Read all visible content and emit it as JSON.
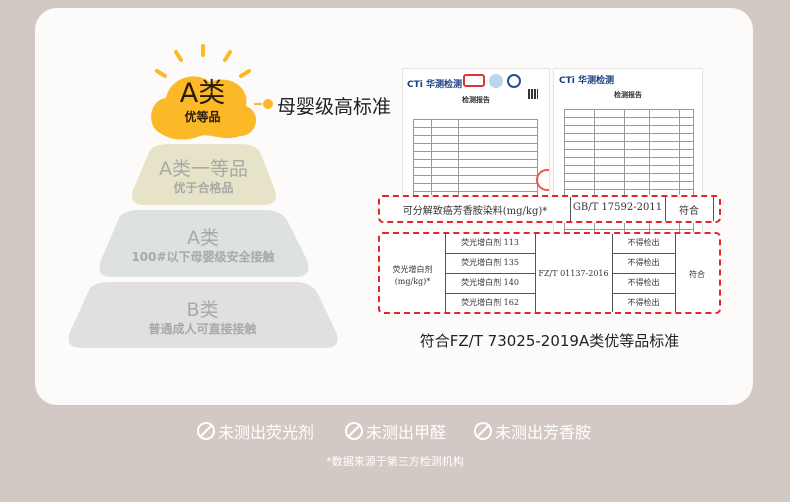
{
  "pyramid": {
    "top": {
      "title": "A类",
      "subtitle": "优等品",
      "callout": "母婴级高标准"
    },
    "tiers": [
      {
        "title": "A类一等品",
        "subtitle": "优于合格品"
      },
      {
        "title": "A类",
        "subtitle": "100#以下母婴级安全接触"
      },
      {
        "title": "B类",
        "subtitle": "普通成人可直接接触"
      }
    ]
  },
  "report": {
    "doc1": {
      "logo": "CTi 华测检测",
      "title": "检测报告"
    },
    "doc2": {
      "logo": "CTi 华测检测",
      "title": "检测报告"
    },
    "row1": {
      "item": "可分解致癌芳香胺染料(mg/kg)*",
      "standard": "GB/T 17592-2011",
      "result": "符合"
    },
    "row2": {
      "item": "荧光增白剂",
      "unit": "(mg/kg)*",
      "subitems": [
        "荧光增白剂 113",
        "荧光增白剂 135",
        "荧光增白剂 140",
        "荧光增白剂 162"
      ],
      "standard": "FZ/T 01137-2016",
      "values": [
        "不得检出",
        "不得检出",
        "不得检出",
        "不得检出"
      ],
      "result": "符合"
    },
    "caption": "符合FZ/T 73025-2019A类优等品标准"
  },
  "footer": {
    "badges": [
      "未测出荧光剂",
      "未测出甲醛",
      "未测出芳香胺"
    ],
    "note": "*数据来源于第三方检测机构"
  },
  "colors": {
    "accent": "#fbb928",
    "highlight": "#e42626",
    "background": "#d3c9c4"
  }
}
